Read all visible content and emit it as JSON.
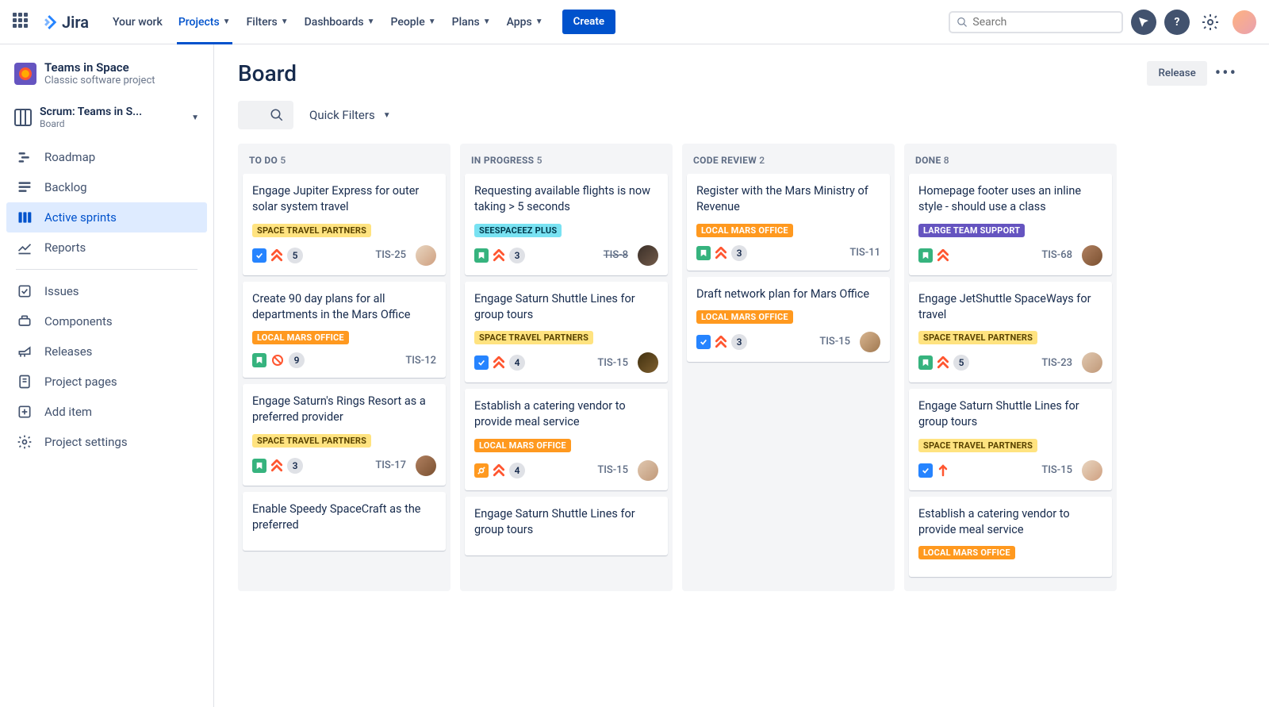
{
  "nav": {
    "product": "Jira",
    "items": [
      "Your work",
      "Projects",
      "Filters",
      "Dashboards",
      "People",
      "Plans",
      "Apps"
    ],
    "active": "Projects",
    "create": "Create",
    "search_placeholder": "Search"
  },
  "sidebar": {
    "project_name": "Teams in Space",
    "project_type": "Classic software project",
    "board_name": "Scrum: Teams in S...",
    "board_sub": "Board",
    "items": [
      {
        "label": "Roadmap",
        "icon": "roadmap"
      },
      {
        "label": "Backlog",
        "icon": "backlog"
      },
      {
        "label": "Active sprints",
        "icon": "board",
        "active": true
      },
      {
        "label": "Reports",
        "icon": "reports"
      }
    ],
    "items2": [
      {
        "label": "Issues",
        "icon": "issues"
      },
      {
        "label": "Components",
        "icon": "components"
      },
      {
        "label": "Releases",
        "icon": "releases"
      },
      {
        "label": "Project pages",
        "icon": "pages"
      },
      {
        "label": "Add item",
        "icon": "add"
      },
      {
        "label": "Project settings",
        "icon": "settings"
      }
    ]
  },
  "main": {
    "title": "Board",
    "release": "Release",
    "quick_filters": "Quick Filters"
  },
  "epics": {
    "stp": "SPACE TRAVEL PARTNERS",
    "ssp": "SEESPACEEZ PLUS",
    "lmo": "LOCAL MARS OFFICE",
    "lts": "LARGE TEAM SUPPORT"
  },
  "board": {
    "columns": [
      {
        "name": "To Do",
        "count": 5,
        "cards": [
          {
            "title": "Engage Jupiter Express for outer solar system travel",
            "epic": "stp",
            "epic_color": "yellow",
            "type": "task",
            "prio": "highest",
            "sp": "5",
            "key": "TIS-25",
            "avatar": "av1"
          },
          {
            "title": "Create 90 day plans for all departments in the Mars Office",
            "epic": "lmo",
            "epic_color": "orange",
            "type": "story",
            "prio": "blocker",
            "sp": "9",
            "key": "TIS-12",
            "avatar": ""
          },
          {
            "title": "Engage Saturn's Rings Resort as a preferred provider",
            "epic": "stp",
            "epic_color": "yellow",
            "type": "story",
            "prio": "highest",
            "sp": "3",
            "key": "TIS-17",
            "avatar": "av3"
          },
          {
            "title": "Enable Speedy SpaceCraft as the preferred",
            "epic": "",
            "epic_color": "",
            "type": "",
            "prio": "",
            "sp": "",
            "key": "",
            "avatar": ""
          }
        ]
      },
      {
        "name": "In Progress",
        "count": 5,
        "cards": [
          {
            "title": "Requesting available flights is now taking > 5 seconds",
            "epic": "ssp",
            "epic_color": "teal",
            "type": "story",
            "prio": "highest",
            "sp": "3",
            "key": "TIS-8",
            "key_done": true,
            "avatar": "av2"
          },
          {
            "title": "Engage Saturn Shuttle Lines for group tours",
            "epic": "stp",
            "epic_color": "yellow",
            "type": "task",
            "prio": "highest",
            "sp": "4",
            "key": "TIS-15",
            "avatar": "av4"
          },
          {
            "title": "Establish a catering vendor to provide meal service",
            "epic": "lmo",
            "epic_color": "orange",
            "type": "sub",
            "prio": "highest",
            "sp": "4",
            "key": "TIS-15",
            "avatar": "av5"
          },
          {
            "title": "Engage Saturn Shuttle Lines for group tours",
            "epic": "",
            "epic_color": "",
            "type": "",
            "prio": "",
            "sp": "",
            "key": "",
            "avatar": ""
          }
        ]
      },
      {
        "name": "Code Review",
        "count": 2,
        "cards": [
          {
            "title": "Register with the Mars Ministry of Revenue",
            "epic": "lmo",
            "epic_color": "orange",
            "type": "story",
            "prio": "highest",
            "sp": "3",
            "key": "TIS-11",
            "avatar": ""
          },
          {
            "title": "Draft network plan for Mars Office",
            "epic": "lmo",
            "epic_color": "orange",
            "type": "task",
            "prio": "highest",
            "sp": "3",
            "key": "TIS-15",
            "avatar": "av6"
          }
        ]
      },
      {
        "name": "Done",
        "count": 8,
        "cards": [
          {
            "title": "Homepage footer uses an inline style - should use a class",
            "epic": "lts",
            "epic_color": "purple",
            "type": "story",
            "prio": "highest",
            "sp": "",
            "key": "TIS-68",
            "avatar": "av3"
          },
          {
            "title": "Engage JetShuttle SpaceWays for travel",
            "epic": "stp",
            "epic_color": "yellow",
            "type": "story",
            "prio": "highest",
            "sp": "5",
            "key": "TIS-23",
            "avatar": "av5"
          },
          {
            "title": "Engage Saturn Shuttle Lines for group tours",
            "epic": "stp",
            "epic_color": "yellow",
            "type": "task",
            "prio": "high",
            "sp": "",
            "key": "TIS-15",
            "avatar": "av1"
          },
          {
            "title": "Establish a catering vendor to provide meal service",
            "epic": "lmo",
            "epic_color": "orange",
            "type": "",
            "prio": "",
            "sp": "",
            "key": "",
            "avatar": ""
          }
        ]
      }
    ]
  }
}
